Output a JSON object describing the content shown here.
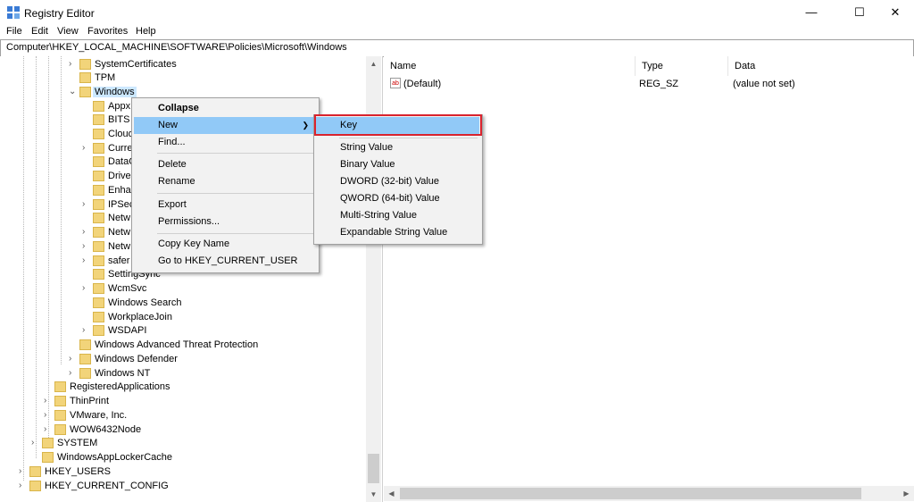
{
  "window": {
    "title": "Registry Editor"
  },
  "menubar": [
    "File",
    "Edit",
    "View",
    "Favorites",
    "Help"
  ],
  "address": "Computer\\HKEY_LOCAL_MACHINE\\SOFTWARE\\Policies\\Microsoft\\Windows",
  "tree": [
    {
      "label": "SystemCertificates",
      "chev": "›"
    },
    {
      "label": "TPM",
      "chev": ""
    },
    {
      "label": "Windows",
      "chev": "⌄"
    },
    {
      "label": "Appx",
      "chev": ""
    },
    {
      "label": "BITS",
      "chev": ""
    },
    {
      "label": "Cloud",
      "chev": ""
    },
    {
      "label": "Curre",
      "chev": "›"
    },
    {
      "label": "DataC",
      "chev": ""
    },
    {
      "label": "Driver",
      "chev": ""
    },
    {
      "label": "Enhar",
      "chev": ""
    },
    {
      "label": "IPSec",
      "chev": "›"
    },
    {
      "label": "Netw",
      "chev": ""
    },
    {
      "label": "Netw",
      "chev": "›"
    },
    {
      "label": "Netw",
      "chev": "›"
    },
    {
      "label": "safer",
      "chev": "›"
    },
    {
      "label": "SettingSync",
      "chev": ""
    },
    {
      "label": "WcmSvc",
      "chev": "›"
    },
    {
      "label": "Windows Search",
      "chev": ""
    },
    {
      "label": "WorkplaceJoin",
      "chev": ""
    },
    {
      "label": "WSDAPI",
      "chev": "›"
    },
    {
      "label": "Windows Advanced Threat Protection",
      "chev": ""
    },
    {
      "label": "Windows Defender",
      "chev": "›"
    },
    {
      "label": "Windows NT",
      "chev": "›"
    },
    {
      "label": "RegisteredApplications",
      "chev": ""
    },
    {
      "label": "ThinPrint",
      "chev": "›"
    },
    {
      "label": "VMware, Inc.",
      "chev": "›"
    },
    {
      "label": "WOW6432Node",
      "chev": "›"
    },
    {
      "label": "SYSTEM",
      "chev": "›"
    },
    {
      "label": "WindowsAppLockerCache",
      "chev": ""
    },
    {
      "label": "HKEY_USERS",
      "chev": "›"
    },
    {
      "label": "HKEY_CURRENT_CONFIG",
      "chev": "›"
    }
  ],
  "list": {
    "columns": [
      "Name",
      "Type",
      "Data"
    ],
    "rows": [
      {
        "name": "(Default)",
        "type": "REG_SZ",
        "data": "(value not set)"
      }
    ]
  },
  "context_menu": [
    "Collapse",
    "New",
    "Find...",
    "Delete",
    "Rename",
    "Export",
    "Permissions...",
    "Copy Key Name",
    "Go to HKEY_CURRENT_USER"
  ],
  "submenu": [
    "Key",
    "String Value",
    "Binary Value",
    "DWORD (32-bit) Value",
    "QWORD (64-bit) Value",
    "Multi-String Value",
    "Expandable String Value"
  ],
  "icons": {
    "app": "registry-icon",
    "value": "string-value-icon"
  },
  "colors": {
    "highlight": "#91c9f7",
    "selection": "#cce8ff",
    "callout": "#d9232e",
    "folder": "#f2d47a"
  }
}
